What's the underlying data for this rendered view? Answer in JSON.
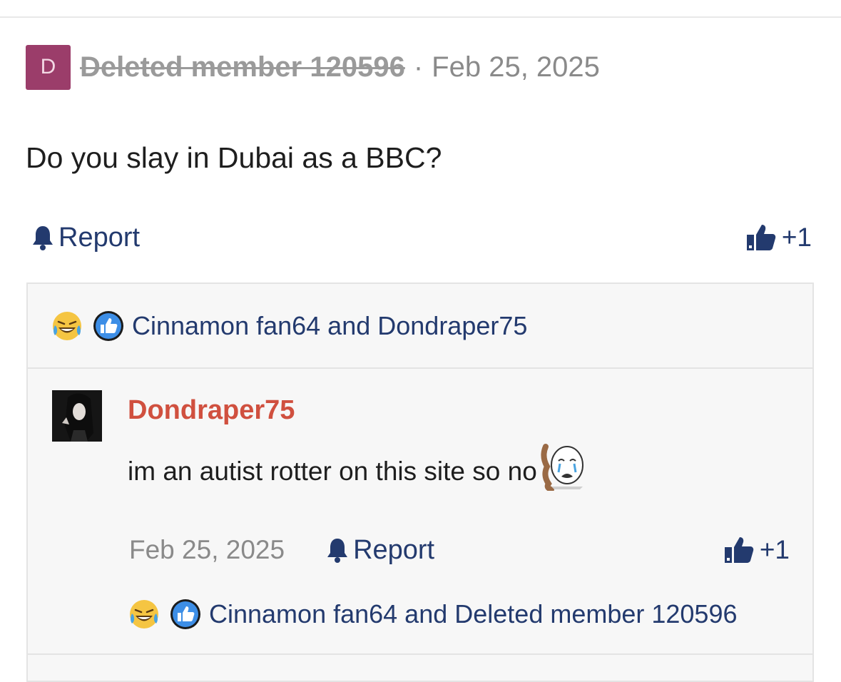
{
  "post": {
    "avatar_letter": "D",
    "author": "Deleted member 120596",
    "separator": "·",
    "date": "Feb 25, 2025",
    "body": "Do you slay in Dubai as a BBC?",
    "report_label": "Report",
    "like_count": "+1"
  },
  "reactions": {
    "names": "Cinnamon fan64 and Dondraper75",
    "icons": [
      "laughing-crying-emoji",
      "like-icon"
    ]
  },
  "reply": {
    "author": "Dondraper75",
    "text": "im an autist rotter on this site so no",
    "date": "Feb 25, 2025",
    "report_label": "Report",
    "like_count": "+1",
    "reactions": {
      "names": "Cinnamon fan64 and Deleted member 120596"
    }
  },
  "colors": {
    "link": "#233a6e",
    "reply_author": "#d0503f",
    "avatar_bg": "#9b3d6a"
  }
}
